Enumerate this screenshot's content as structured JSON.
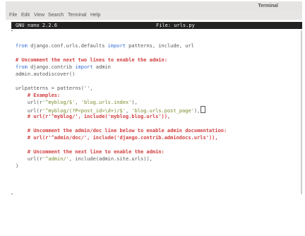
{
  "window": {
    "title": "Terminal"
  },
  "menu": [
    "File",
    "Edit",
    "View",
    "Search",
    "Terminal",
    "Help"
  ],
  "nano": {
    "version": "GNU nano 2.2.6",
    "file": "File: urls.py"
  },
  "code": {
    "l1_kw1": "from",
    "l1_mid": " django.conf.urls.defaults ",
    "l1_kw2": "import",
    "l1_end": " patterns, include, url",
    "l2": "# Uncomment the next two lines to enable the admin:",
    "l3_kw1": "from",
    "l3_mid": " django.contrib ",
    "l3_kw2": "import",
    "l3_end": " admin",
    "l4": "admin.autodiscover()",
    "l5": "urlpatterns = patterns('',",
    "l6": "    # Examples:",
    "l7_a": "    url(r",
    "l7_s1": "'^myblog/$'",
    "l7_b": ", ",
    "l7_s2": "'blog.urls.index'",
    "l7_c": "),",
    "l8_a": "    url(r",
    "l8_s1": "'^myblog/(?P<post_id>\\d+)/$'",
    "l8_b": ", ",
    "l8_s2": "'blog.urls.post_page'",
    "l8_c": "),",
    "l9": "    # url(r'^myblog/', include('myblog.blog.urls')),",
    "l10": "    # Uncomment the admin/doc line below to enable admin documentation:",
    "l11": "    # url(r'^admin/doc/', include('django.contrib.admindocs.urls')),",
    "l12": "    # Uncomment the next line to enable the admin:",
    "l13_a": "    url(r",
    "l13_s1": "'^admin/'",
    "l13_c": ", include(admin.site.urls)),",
    "l14": ")"
  }
}
